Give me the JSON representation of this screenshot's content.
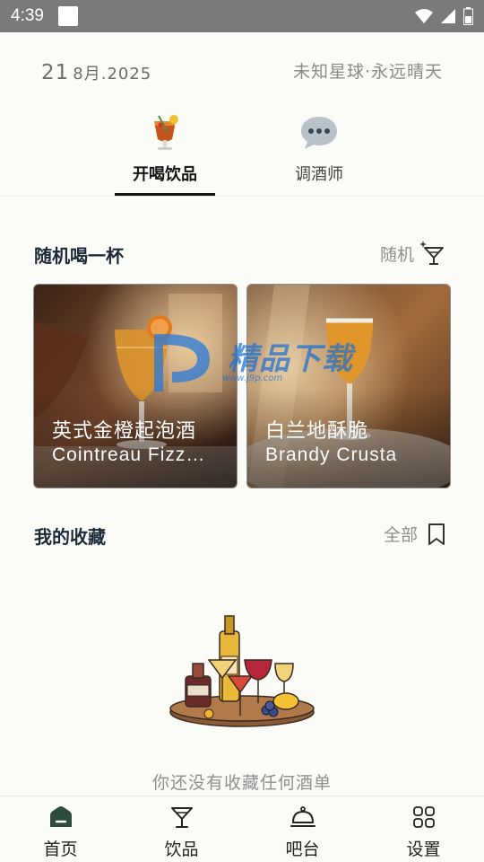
{
  "status_bar": {
    "time": "4:39"
  },
  "header": {
    "date_day": "21",
    "date_month_year": "8月.2025",
    "motto": "未知星球·永远晴天"
  },
  "tabs": [
    {
      "label": "开喝饮品",
      "icon": "cocktail-icon",
      "active": true
    },
    {
      "label": "调酒师",
      "icon": "speech-bubble-icon",
      "active": false
    }
  ],
  "random_section": {
    "title": "随机喝一杯",
    "action_label": "随机",
    "action_icon": "cocktail-glass-sparkle-icon",
    "cards": [
      {
        "name_cn": "英式金橙起泡酒",
        "name_en": "Cointreau Fizz…"
      },
      {
        "name_cn": "白兰地酥脆",
        "name_en": "Brandy Crusta"
      }
    ]
  },
  "favorites_section": {
    "title": "我的收藏",
    "action_label": "全部",
    "action_icon": "bookmark-icon",
    "empty_text": "你还没有收藏任何酒单"
  },
  "watermark": {
    "brand": "精品下载",
    "url": "www.j9p.com"
  },
  "bottom_nav": [
    {
      "label": "首页",
      "icon": "home-icon",
      "active": true
    },
    {
      "label": "饮品",
      "icon": "cocktail-glass-icon",
      "active": false
    },
    {
      "label": "吧台",
      "icon": "bar-bell-icon",
      "active": false
    },
    {
      "label": "设置",
      "icon": "grid-settings-icon",
      "active": false
    }
  ],
  "colors": {
    "background": "#fbfbf7",
    "title": "#1d2a3a",
    "muted": "#8e8e8e",
    "active_home": "#2f4b3c",
    "watermark_blue": "#1a6fd1"
  }
}
